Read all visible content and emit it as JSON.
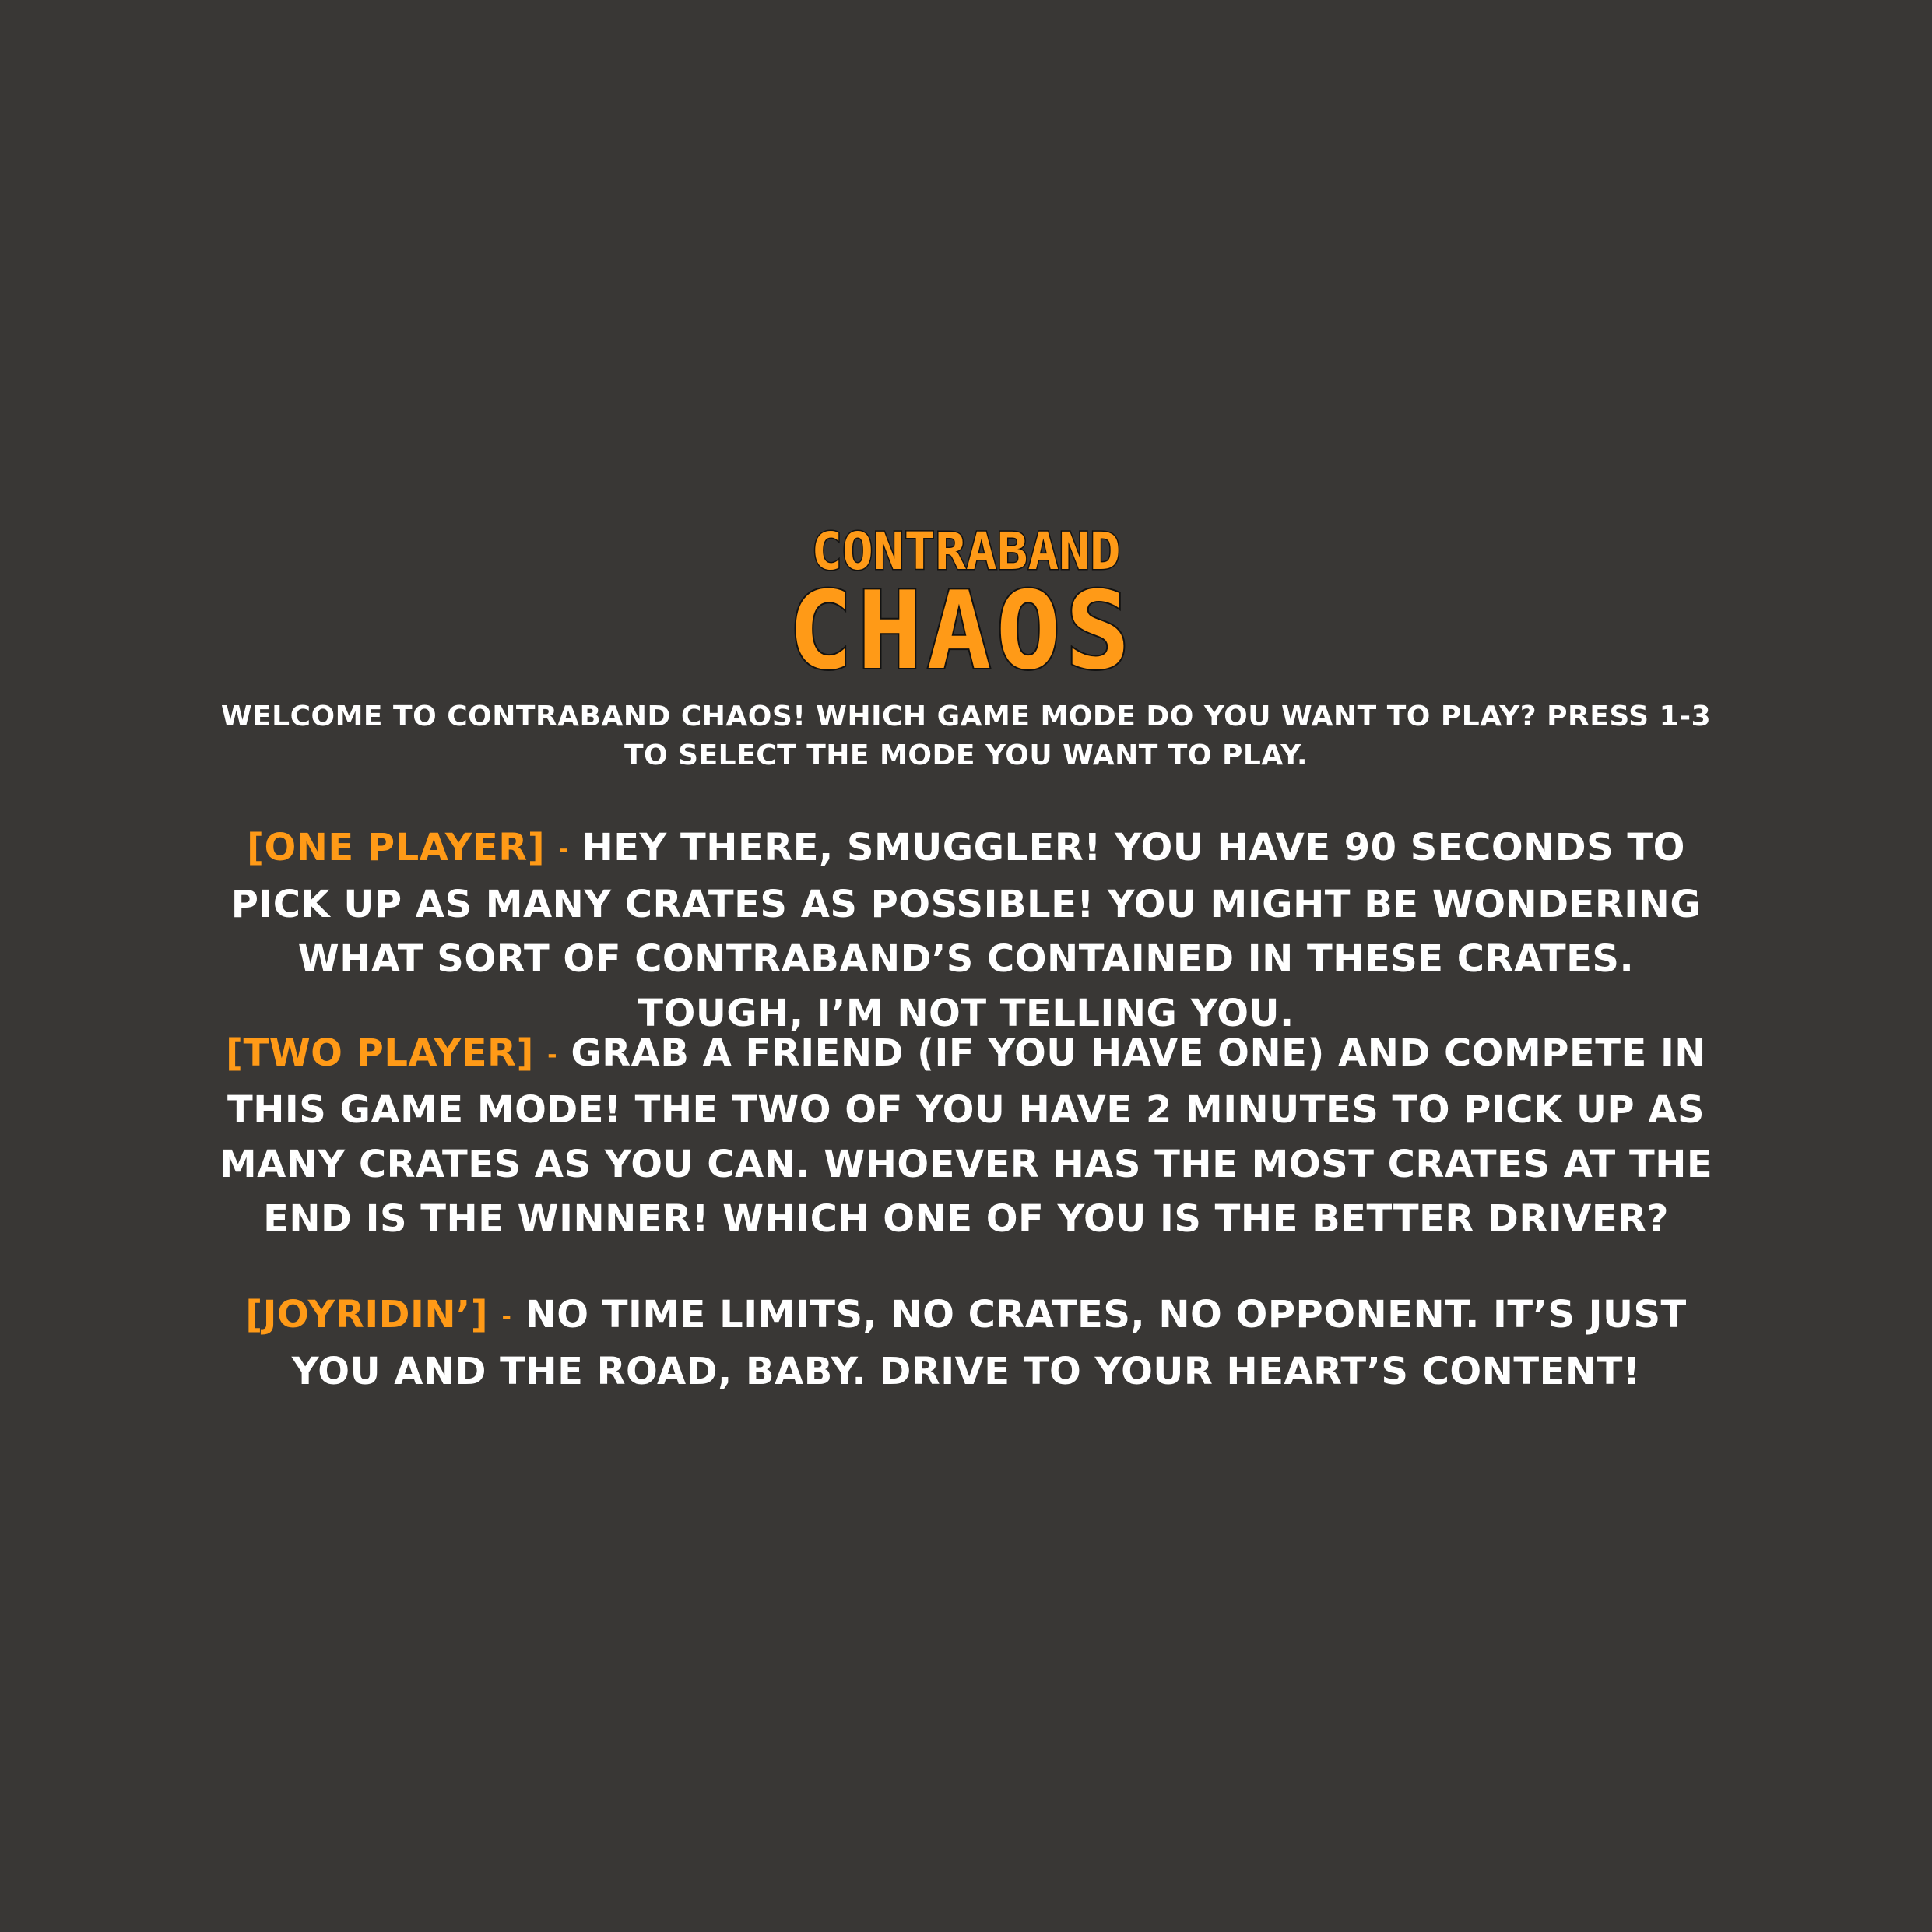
{
  "logo": {
    "line1": "CONTRABAND",
    "line2": "CHAOS"
  },
  "intro": "WELCOME TO CONTRABAND CHAOS! WHICH GAME MODE DO YOU WANT TO PLAY? PRESS 1-3 TO SELECT THE MODE YOU WANT TO PLAY.",
  "modes": [
    {
      "tag": "[ONE PLAYER]",
      "separator": "-",
      "description": "HEY THERE, SMUGGLER! YOU HAVE 90 SECONDS TO PICK UP AS MANY CRATES AS POSSIBLE! YOU MIGHT BE WONDERING WHAT SORT OF CONTRABAND’S CONTAINED IN THESE CRATES. TOUGH, I’M NOT TELLING YOU."
    },
    {
      "tag": "[TWO PLAYER]",
      "separator": "-",
      "description": "GRAB A FRIEND (IF YOU HAVE ONE) AND COMPETE IN THIS GAME MODE! THE TWO OF YOU HAVE 2 MINUTES TO PICK UP AS MANY CRATES AS YOU CAN. WHOEVER HAS THE MOST CRATES AT THE END IS THE WINNER! WHICH ONE OF YOU IS THE BETTER DRIVER?"
    },
    {
      "tag": "[JOYRIDIN’]",
      "separator": "-",
      "description": "NO TIME LIMITS, NO CRATES, NO OPPONENT. IT’S JUST YOU AND THE ROAD, BABY. DRIVE TO YOUR HEART’S CONTENT!"
    }
  ],
  "colors": {
    "background": "#393735",
    "accent": "#ff9a17",
    "text": "#ffffff",
    "logo_outline": "#121212"
  }
}
